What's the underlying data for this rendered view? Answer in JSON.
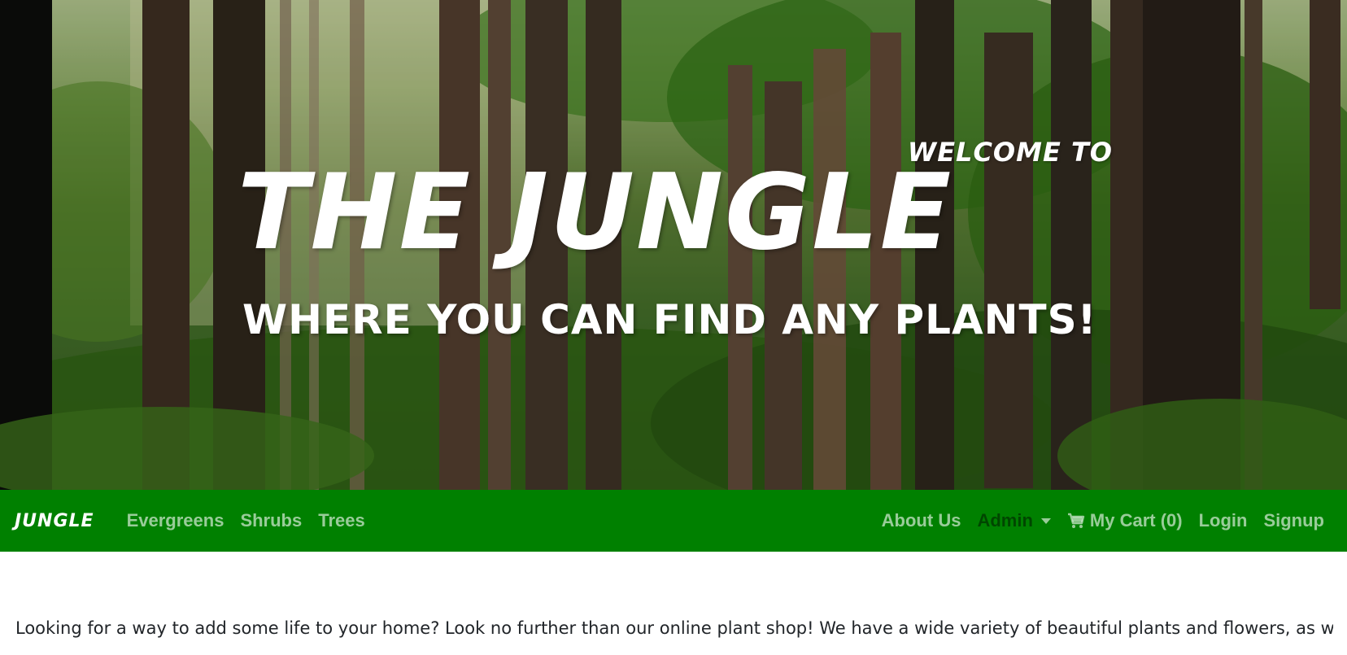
{
  "hero": {
    "welcome": "WELCOME TO",
    "title": "THE JUNGLE",
    "tagline": "WHERE YOU CAN FIND ANY PLANTS!"
  },
  "navbar": {
    "brand": "JUNGLE",
    "left_links": [
      "Evergreens",
      "Shrubs",
      "Trees"
    ],
    "about": "About Us",
    "admin": "Admin",
    "cart": "My Cart (0)",
    "login": "Login",
    "signup": "Signup",
    "background_color": "#008000"
  },
  "intro": {
    "text": "Looking for a way to add some life to your home? Look no further than our online plant shop! We have a wide variety of beautiful plants and flowers, as well"
  },
  "icons": {
    "cart": "shopping-cart-icon",
    "admin_caret": "chevron-down-icon"
  }
}
